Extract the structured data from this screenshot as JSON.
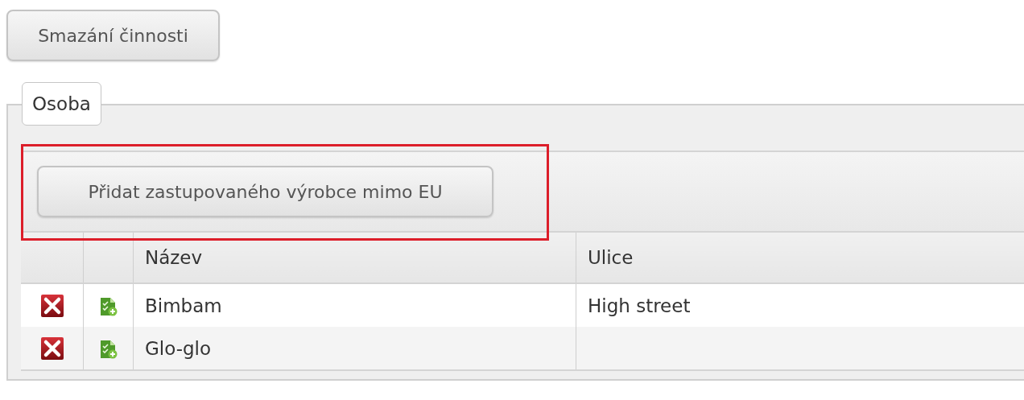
{
  "top_button": {
    "label": "Smazání činnosti"
  },
  "fieldset": {
    "legend": "Osoba",
    "toolbar": {
      "highlighted": true,
      "button": {
        "label": "Přidat zastupovaného výrobce mimo EU"
      }
    },
    "table": {
      "columns": [
        {
          "label": "Název"
        },
        {
          "label": "Ulice"
        }
      ],
      "rows": [
        {
          "cells": [
            "Bimbam",
            "High street"
          ]
        },
        {
          "cells": [
            "Glo-glo"
          ]
        }
      ]
    }
  }
}
